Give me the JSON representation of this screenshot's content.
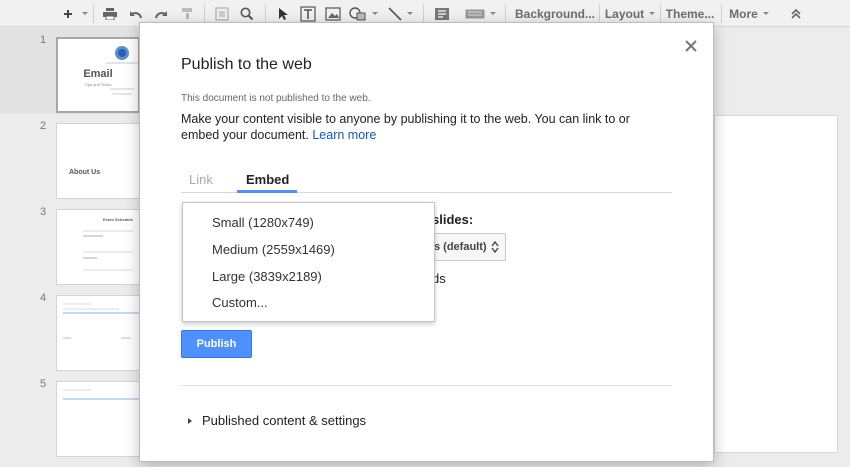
{
  "toolbar": {
    "background_label": "Background...",
    "layout_label": "Layout",
    "theme_label": "Theme...",
    "more_label": "More"
  },
  "filmstrip": {
    "slides": [
      {
        "number": "1",
        "title": "Email",
        "subtitle": "Tips and Tricks"
      },
      {
        "number": "2",
        "title": "About Us"
      },
      {
        "number": "3",
        "title": "Event Schedule"
      },
      {
        "number": "4",
        "title": ""
      },
      {
        "number": "5",
        "title": ""
      }
    ]
  },
  "dialog": {
    "title": "Publish to the web",
    "status": "This document is not published to the web.",
    "description": "Make your content visible to anyone by publishing it to the web. You can link to or embed your document.",
    "learn_more": "Learn more",
    "tabs": [
      {
        "label": "Link",
        "active": false
      },
      {
        "label": "Embed",
        "active": true
      }
    ],
    "slides_label": "slides:",
    "advance_select_value": "s (default)",
    "restart_text": "ds",
    "size_menu": [
      "Small (1280x749)",
      "Medium (2559x1469)",
      "Large (3839x2189)",
      "Custom..."
    ],
    "publish_button": "Publish",
    "published_settings": "Published content & settings"
  },
  "colors": {
    "accent": "#4d90fe",
    "link": "#1155cc"
  }
}
